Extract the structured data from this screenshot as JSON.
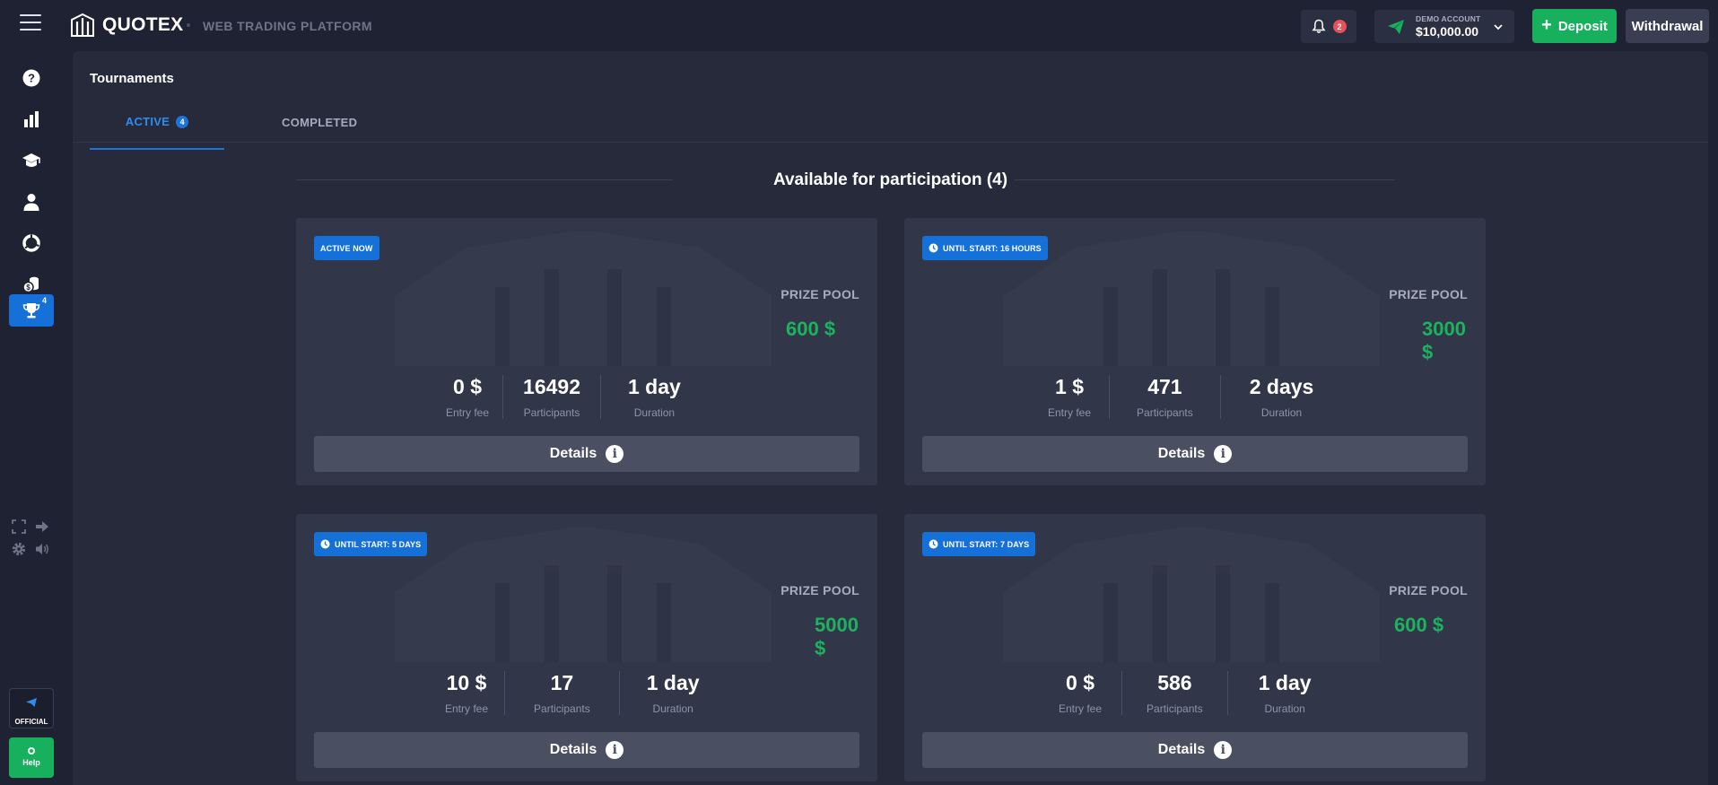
{
  "header": {
    "brand": "QUOTEX",
    "platform_label": "WEB TRADING PLATFORM",
    "notifications_count": "2",
    "account_label": "DEMO ACCOUNT",
    "account_balance": "$10,000.00",
    "deposit_label": "Deposit",
    "withdrawal_label": "Withdrawal"
  },
  "sidebar": {
    "items": [
      {
        "icon": "help-circle-icon"
      },
      {
        "icon": "bar-chart-icon"
      },
      {
        "icon": "graduation-cap-icon"
      },
      {
        "icon": "user-icon"
      },
      {
        "icon": "pie-chart-icon"
      },
      {
        "icon": "coins-icon"
      },
      {
        "icon": "trophy-icon",
        "active": true,
        "count": "4"
      }
    ],
    "official_label": "OFFICIAL",
    "help_label": "Help"
  },
  "page": {
    "title": "Tournaments",
    "tabs": [
      {
        "label": "ACTIVE",
        "count": "4"
      },
      {
        "label": "COMPLETED"
      }
    ],
    "section_title": "Available for participation (4)"
  },
  "labels": {
    "prize_pool": "PRIZE POOL",
    "entry_fee": "Entry fee",
    "participants": "Participants",
    "duration": "Duration",
    "details": "Details"
  },
  "tournaments": [
    {
      "tag": "ACTIVE NOW",
      "tag_icon": "none",
      "prize": "600 $",
      "entry_fee": "0 $",
      "participants": "16492",
      "duration": "1 day"
    },
    {
      "tag": "UNTIL START: 16 HOURS",
      "tag_icon": "clock-icon",
      "prize": "3000 $",
      "entry_fee": "1 $",
      "participants": "471",
      "duration": "2 days"
    },
    {
      "tag": "UNTIL START: 5 DAYS",
      "tag_icon": "clock-icon",
      "prize": "5000 $",
      "entry_fee": "10 $",
      "participants": "17",
      "duration": "1 day"
    },
    {
      "tag": "UNTIL START: 7 DAYS",
      "tag_icon": "clock-icon",
      "prize": "600 $",
      "entry_fee": "0 $",
      "participants": "586",
      "duration": "1 day"
    }
  ],
  "colors": {
    "accent_blue": "#1571d8",
    "prize_green": "#1cb35f",
    "deposit_green": "#17b15e",
    "notification_red": "#e8505b"
  }
}
